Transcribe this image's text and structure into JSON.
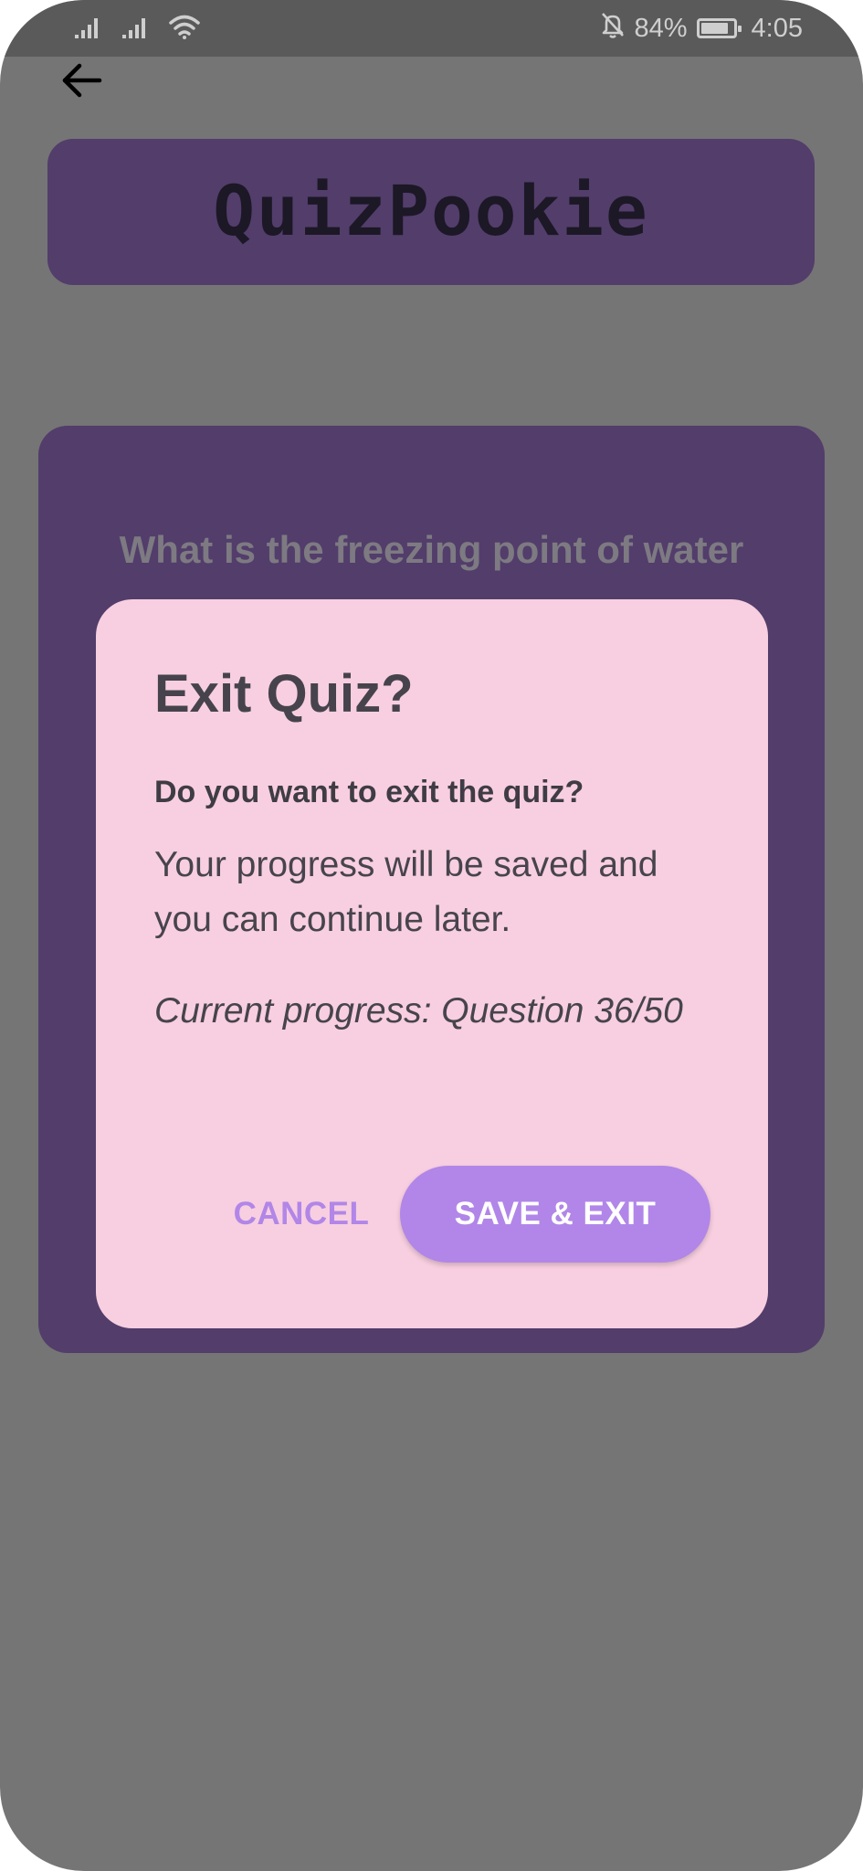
{
  "status_bar": {
    "battery_percent": "84%",
    "battery_level": 0.84,
    "time": "4:05",
    "icons": [
      "signal-icon",
      "signal-icon",
      "wifi-icon",
      "bell-off-icon",
      "battery-icon"
    ]
  },
  "header": {
    "back_icon": "arrow-left-icon",
    "app_title": "QuizPookie"
  },
  "question": {
    "text": "What is the freezing point of water"
  },
  "dialog": {
    "title": "Exit Quiz?",
    "subtitle": "Do you want to exit the quiz?",
    "body": "Your progress will be saved and you can continue later.",
    "progress": "Current progress: Question 36/50",
    "cancel_label": "CANCEL",
    "save_label": "SAVE & EXIT"
  },
  "colors": {
    "overlay_background": "#757575",
    "card_purple": "#523d6b",
    "dialog_pink": "#f8cfe0",
    "accent_purple": "#b186e8"
  }
}
